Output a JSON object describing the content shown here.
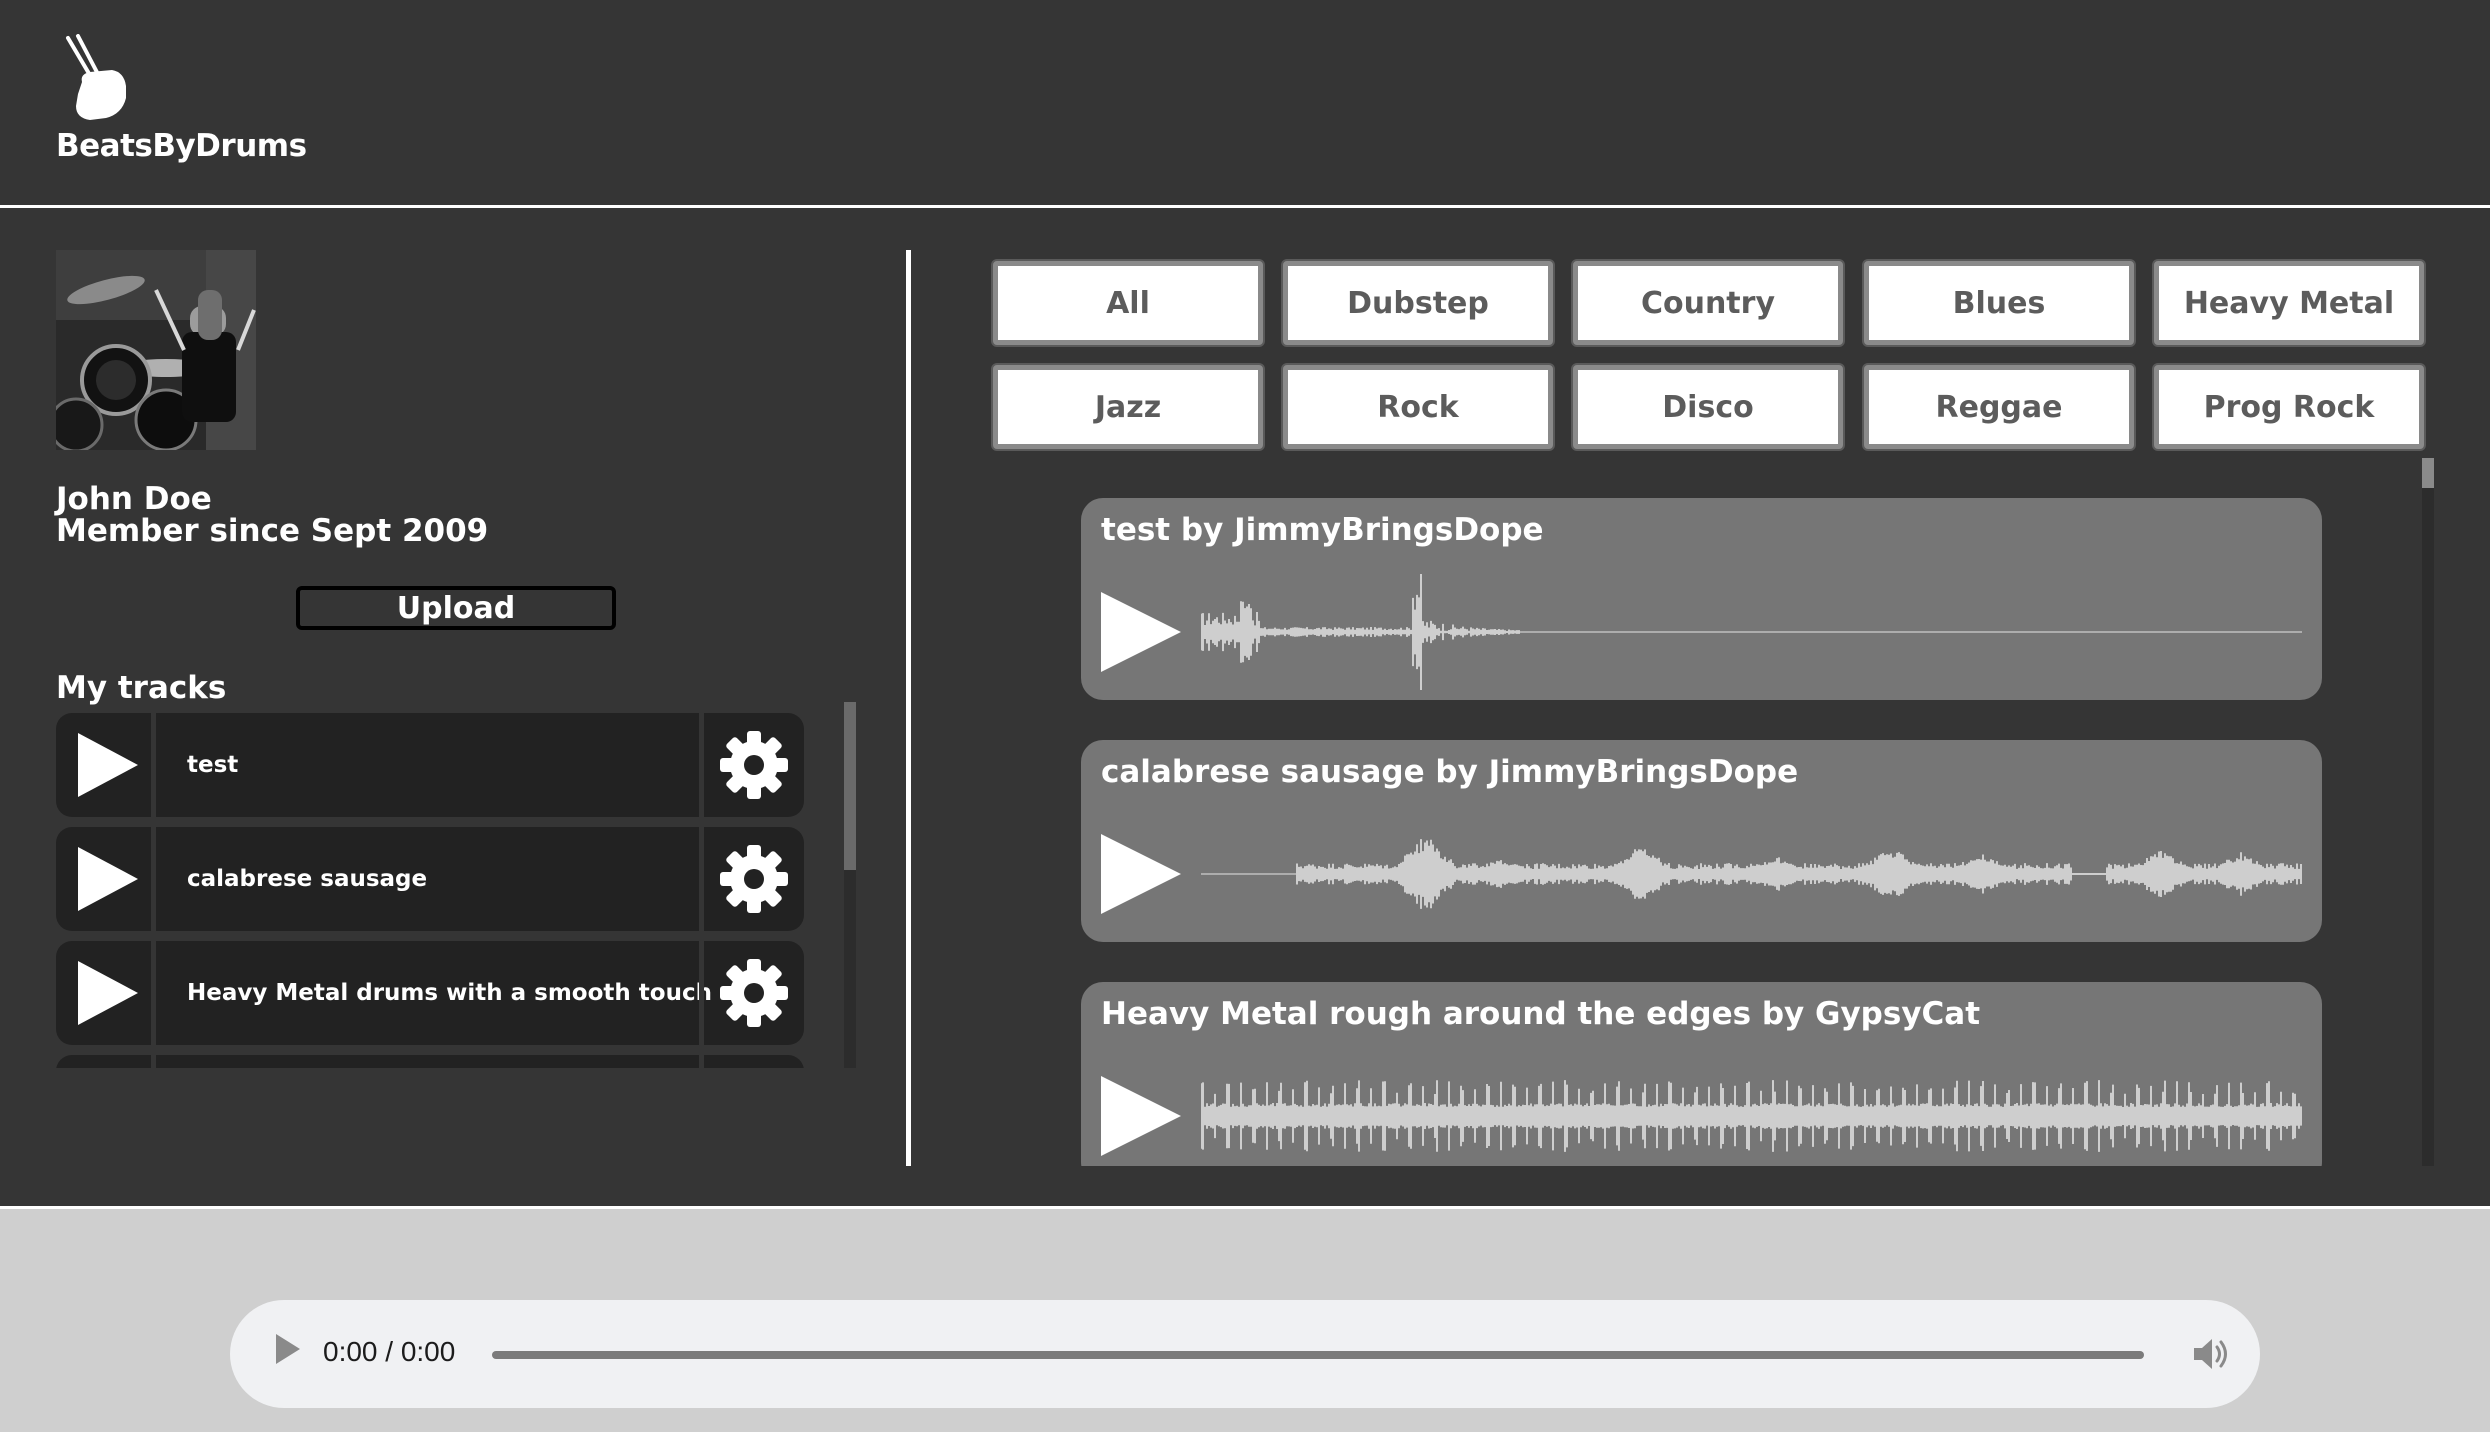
{
  "brand": {
    "name": "BeatsByDrums",
    "logo_icon": "drumsticks-hand-icon"
  },
  "profile": {
    "name": "John Doe",
    "member_since": "Member since Sept 2009",
    "upload_label": "Upload"
  },
  "my_tracks": {
    "title": "My tracks",
    "items": [
      {
        "title": "test"
      },
      {
        "title": "calabrese sausage"
      },
      {
        "title": "Heavy Metal drums with a smooth touch"
      }
    ]
  },
  "genres": [
    "All",
    "Dubstep",
    "Country",
    "Blues",
    "Heavy Metal",
    "Jazz",
    "Rock",
    "Disco",
    "Reggae",
    "Prog Rock"
  ],
  "feed": [
    {
      "title": "test by JimmyBringsDope"
    },
    {
      "title": "calabrese sausage by JimmyBringsDope"
    },
    {
      "title": "Heavy Metal rough around the edges by GypsyCat"
    }
  ],
  "player": {
    "time": "0:00 / 0:00"
  },
  "colors": {
    "background": "#353535",
    "card": "#767676",
    "track_row": "#222222",
    "footer": "#cfcfcf",
    "player": "#f0f1f3",
    "genre_text": "#5c5c5c"
  }
}
